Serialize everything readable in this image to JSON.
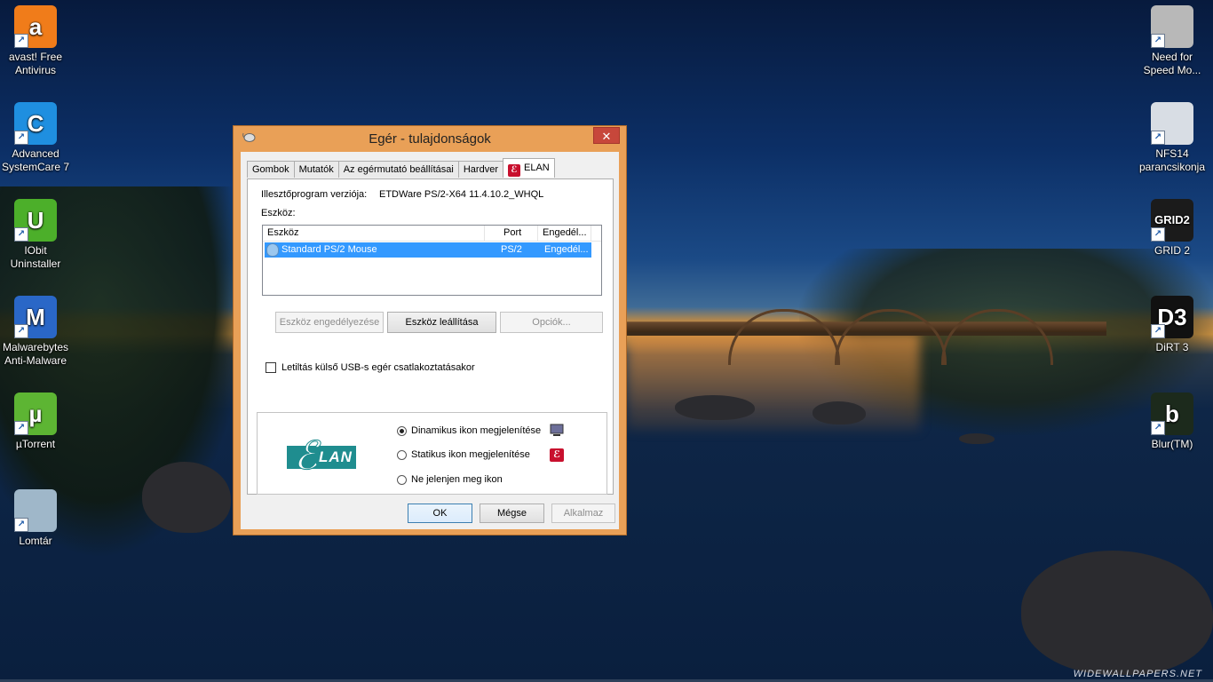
{
  "desktop": {
    "left_icons": [
      {
        "label": "avast! Free Antivirus",
        "color": "#f07c1a",
        "glyph": "a"
      },
      {
        "label": "Advanced SystemCare 7",
        "color": "#1f8fe0",
        "glyph": "C"
      },
      {
        "label": "IObit Uninstaller",
        "color": "#4caf2a",
        "glyph": "U"
      },
      {
        "label": "Malwarebytes Anti-Malware",
        "color": "#2a67c7",
        "glyph": "M"
      },
      {
        "label": "µTorrent",
        "color": "#5db533",
        "glyph": "µ"
      },
      {
        "label": "Lomtár",
        "color": "#9fb7c9",
        "glyph": ""
      }
    ],
    "right_icons": [
      {
        "label": "Need for Speed Mo...",
        "color": "#b8b8b8",
        "glyph": ""
      },
      {
        "label": "NFS14 parancsikonja",
        "color": "#d8dde4",
        "glyph": ""
      },
      {
        "label": "GRID 2",
        "color": "#1b1b1b",
        "glyph": "GRID2"
      },
      {
        "label": "DiRT 3",
        "color": "#111111",
        "glyph": "D3"
      },
      {
        "label": "Blur(TM)",
        "color": "#1c2a1c",
        "glyph": "b"
      }
    ],
    "watermark": "WIDEWALLPAPERS.NET",
    "shortcut_arrow_icon": "shortcut-arrow-icon"
  },
  "dialog": {
    "title": "Egér - tulajdonságok",
    "close_symbol": "✕",
    "accent_color": "#e9a057",
    "tabs": [
      "Gombok",
      "Mutatók",
      "Az egérmutató beállításai",
      "Hardver",
      "ELAN"
    ],
    "active_tab": "ELAN",
    "driver_label": "Illesztőprogram verziója:",
    "driver_value": "ETDWare PS/2-X64 11.4.10.2_WHQL",
    "device_label": "Eszköz:",
    "columns": [
      "Eszköz",
      "Port",
      "Engedél..."
    ],
    "rows": [
      {
        "device": "Standard PS/2 Mouse",
        "port": "PS/2",
        "enabled": "Engedél...",
        "selected": true
      }
    ],
    "buttons": {
      "enable": "Eszköz engedélyezése",
      "disable": "Eszköz leállítása",
      "options": "Opciók..."
    },
    "disable_usb_label": "Letiltás külső USB-s egér csatlakoztatásakor",
    "logo_text": "LAN",
    "radio_options": [
      {
        "label": "Dinamikus ikon megjelenítése",
        "checked": true
      },
      {
        "label": "Statikus ikon megjelenítése",
        "checked": false
      },
      {
        "label": "Ne jelenjen meg ikon",
        "checked": false
      }
    ],
    "footer": {
      "ok": "OK",
      "cancel": "Mégse",
      "apply": "Alkalmaz"
    }
  }
}
